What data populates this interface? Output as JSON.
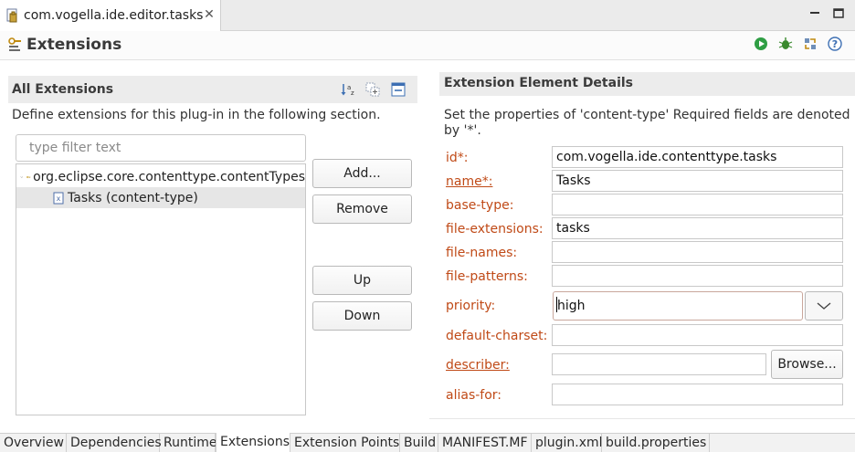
{
  "editor": {
    "tab_title": "com.vogella.ide.editor.tasks",
    "tab_icon": "plugin-manifest-icon",
    "close_icon": "close-icon",
    "window_controls": [
      "minimize-icon",
      "maximize-icon"
    ]
  },
  "form": {
    "title": "Extensions",
    "title_icon": "extensions-icon",
    "actions": [
      "run-icon",
      "debug-icon",
      "export-wizard-icon",
      "help-icon"
    ]
  },
  "all_extensions": {
    "title": "All Extensions",
    "tools": [
      "sort-alpha-icon",
      "expand-all-icon",
      "collapse-all-icon"
    ],
    "description": "Define extensions for this plug-in in the following section.",
    "filter_placeholder": "type filter text",
    "tree": [
      {
        "label": "org.eclipse.core.contenttype.contentTypes",
        "expanded": true,
        "icon": "extension-point-icon"
      },
      {
        "label": "Tasks (content-type)",
        "selected": true,
        "icon": "element-icon"
      }
    ],
    "buttons": {
      "add": "Add...",
      "remove": "Remove",
      "up": "Up",
      "down": "Down"
    }
  },
  "details": {
    "title": "Extension Element Details",
    "description_line1": "Set the properties of 'content-type' Required fields are denoted",
    "description_line2": "by '*'.",
    "fields": {
      "id": {
        "label": "id*:",
        "value": "com.vogella.ide.contenttype.tasks"
      },
      "name": {
        "label": "name*:",
        "value": "Tasks"
      },
      "base_type": {
        "label": "base-type:",
        "value": ""
      },
      "file_extensions": {
        "label": "file-extensions:",
        "value": "tasks"
      },
      "file_names": {
        "label": "file-names:",
        "value": ""
      },
      "file_patterns": {
        "label": "file-patterns:",
        "value": ""
      },
      "priority": {
        "label": "priority:",
        "value": "high"
      },
      "default_charset": {
        "label": "default-charset:",
        "value": ""
      },
      "describer": {
        "label": "describer:",
        "value": "",
        "browse": "Browse..."
      },
      "alias_for": {
        "label": "alias-for:",
        "value": ""
      }
    },
    "colors": {
      "label": "#c04a17"
    }
  },
  "page_tabs": [
    {
      "label": "Overview"
    },
    {
      "label": "Dependencies"
    },
    {
      "label": "Runtime"
    },
    {
      "label": "Extensions",
      "active": true
    },
    {
      "label": "Extension Points"
    },
    {
      "label": "Build"
    },
    {
      "label": "MANIFEST.MF"
    },
    {
      "label": "plugin.xml"
    },
    {
      "label": "build.properties"
    }
  ]
}
